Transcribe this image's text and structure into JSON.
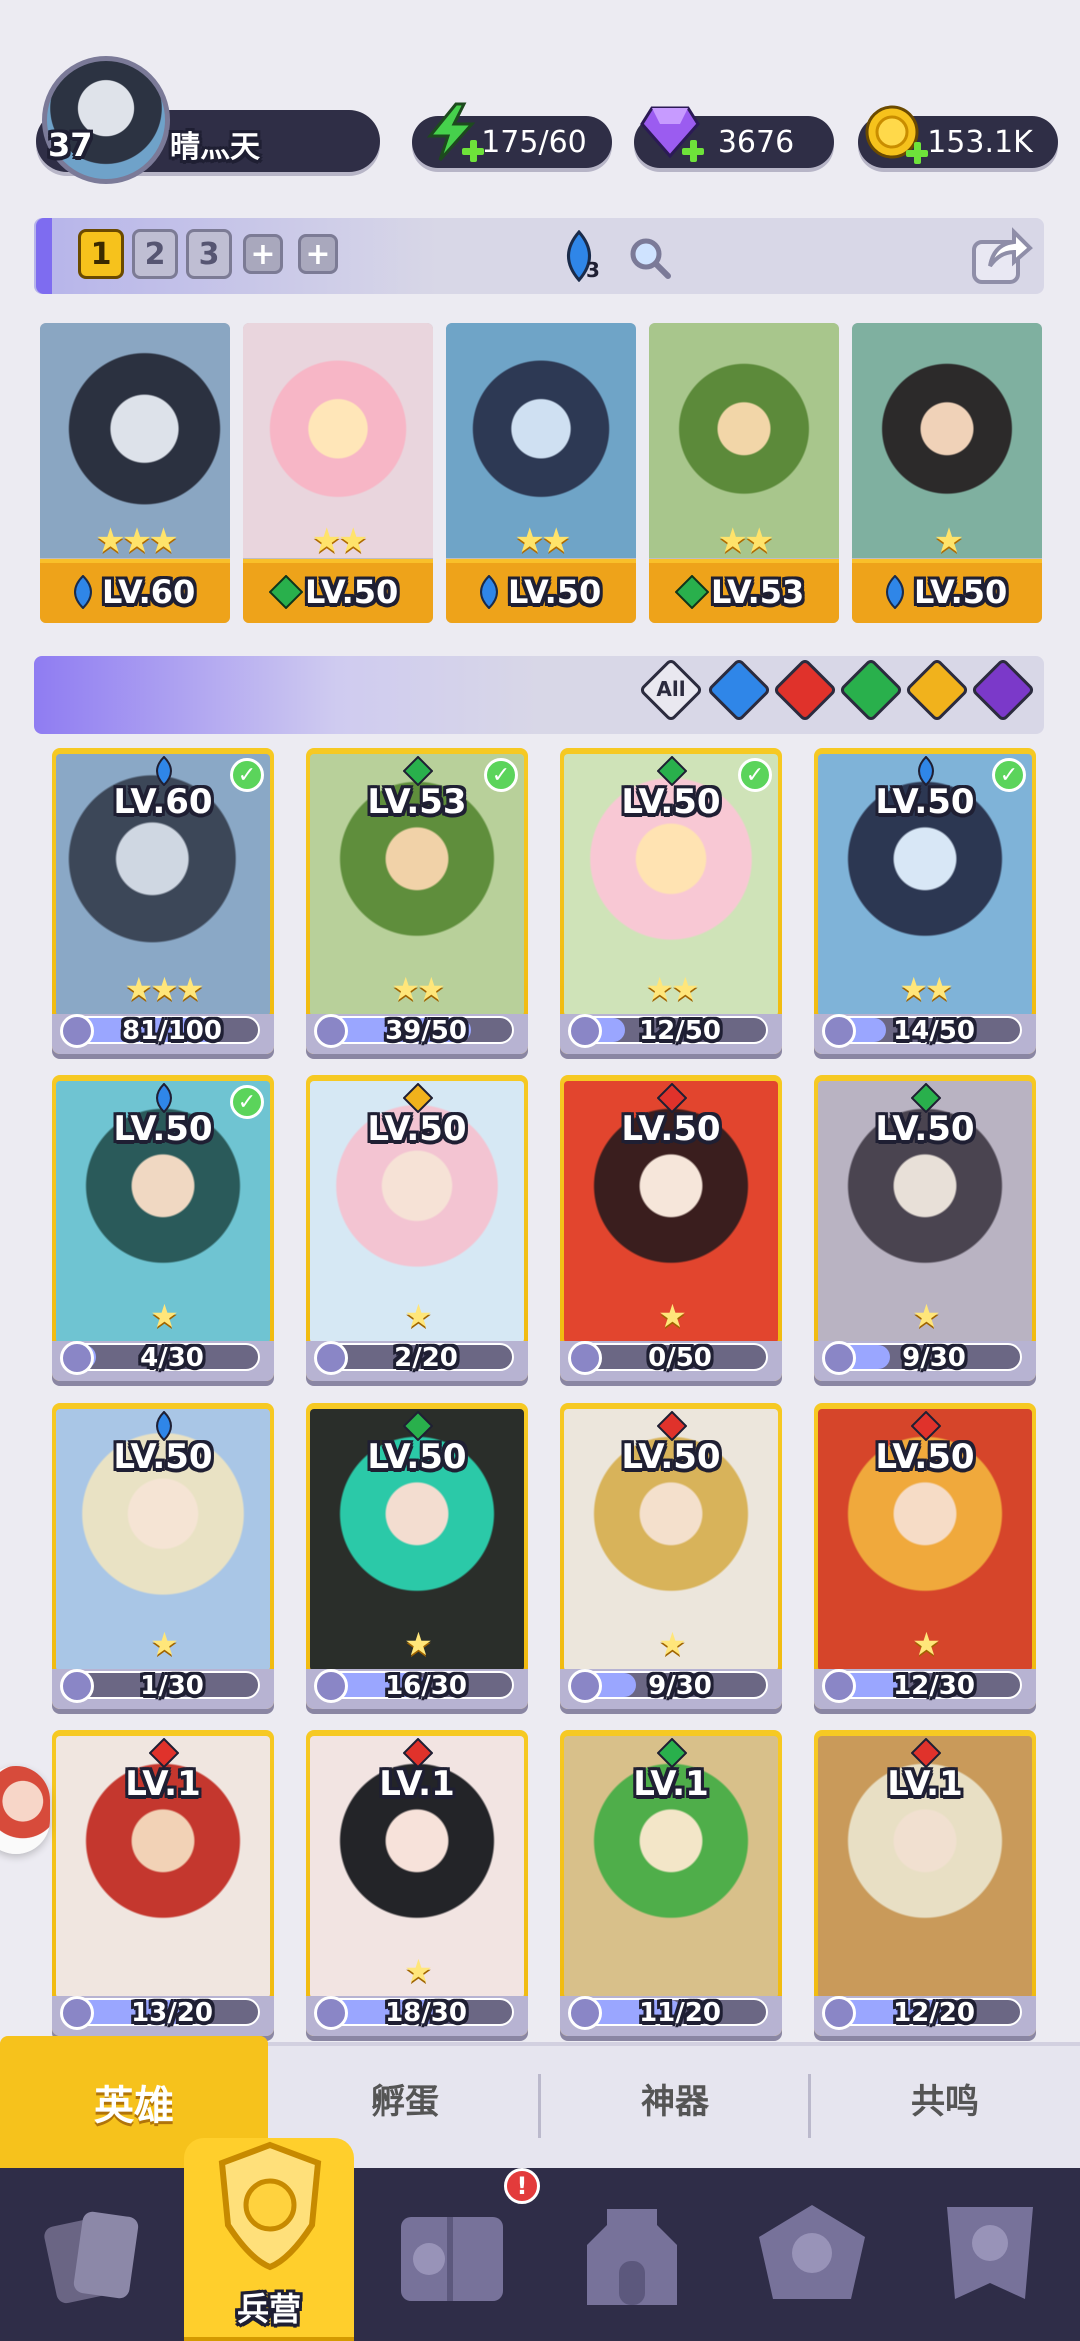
{
  "player": {
    "level": "37",
    "name": "晴灬天"
  },
  "resources": [
    {
      "name": "energy",
      "icon": "lightning-icon",
      "value": "175/60"
    },
    {
      "name": "gems",
      "icon": "diamond-icon",
      "value": "3676"
    },
    {
      "name": "coins",
      "icon": "coin-icon",
      "value": "153.1K"
    }
  ],
  "team_tabs": [
    "1",
    "2",
    "3"
  ],
  "rune_count": "3",
  "team": [
    {
      "level": "LV.60",
      "stars": "★★★",
      "element": "water",
      "color": "#2e7fe0"
    },
    {
      "level": "LV.50",
      "stars": "★★",
      "element": "nature",
      "color": "#2bb34a"
    },
    {
      "level": "LV.50",
      "stars": "★★",
      "element": "water",
      "color": "#2e7fe0"
    },
    {
      "level": "LV.53",
      "stars": "★★",
      "element": "nature",
      "color": "#2bb34a"
    },
    {
      "level": "LV.50",
      "stars": "★",
      "element": "water",
      "color": "#2e7fe0"
    }
  ],
  "filters": {
    "all_label": "All",
    "elements": [
      "water",
      "fire",
      "nature",
      "light",
      "dark"
    ]
  },
  "heroes": [
    {
      "level": "LV.60",
      "element": "water",
      "in_team": true,
      "stars": "★★★",
      "shards": "81/100",
      "progress": 0.81
    },
    {
      "level": "LV.53",
      "element": "nature",
      "in_team": true,
      "stars": "★★",
      "shards": "39/50",
      "progress": 0.78
    },
    {
      "level": "LV.50",
      "element": "nature",
      "in_team": true,
      "stars": "★★",
      "shards": "12/50",
      "progress": 0.24
    },
    {
      "level": "LV.50",
      "element": "water",
      "in_team": true,
      "stars": "★★",
      "shards": "14/50",
      "progress": 0.28
    },
    {
      "level": "LV.50",
      "element": "water",
      "in_team": true,
      "stars": "★",
      "shards": "4/30",
      "progress": 0.13
    },
    {
      "level": "LV.50",
      "element": "light",
      "in_team": false,
      "stars": "★",
      "shards": "2/20",
      "progress": 0.1
    },
    {
      "level": "LV.50",
      "element": "fire",
      "in_team": false,
      "stars": "★",
      "shards": "0/50",
      "progress": 0.0
    },
    {
      "level": "LV.50",
      "element": "nature",
      "in_team": false,
      "stars": "★",
      "shards": "9/30",
      "progress": 0.3
    },
    {
      "level": "LV.50",
      "element": "water",
      "in_team": false,
      "stars": "★",
      "shards": "1/30",
      "progress": 0.03
    },
    {
      "level": "LV.50",
      "element": "nature",
      "in_team": false,
      "stars": "★",
      "shards": "16/30",
      "progress": 0.53
    },
    {
      "level": "LV.50",
      "element": "fire",
      "in_team": false,
      "stars": "★",
      "shards": "9/30",
      "progress": 0.3
    },
    {
      "level": "LV.50",
      "element": "fire",
      "in_team": false,
      "stars": "★",
      "shards": "12/30",
      "progress": 0.4
    },
    {
      "level": "LV.1",
      "element": "fire",
      "in_team": false,
      "stars": "",
      "shards": "13/20",
      "progress": 0.65
    },
    {
      "level": "LV.1",
      "element": "fire",
      "in_team": false,
      "stars": "★",
      "shards": "18/30",
      "progress": 0.6
    },
    {
      "level": "LV.1",
      "element": "nature",
      "in_team": false,
      "stars": "",
      "shards": "11/20",
      "progress": 0.55
    },
    {
      "level": "LV.1",
      "element": "fire",
      "in_team": false,
      "stars": "",
      "shards": "12/20",
      "progress": 0.6
    }
  ],
  "element_colors": {
    "water": "#2f86e8",
    "fire": "#e0322b",
    "nature": "#29b04c",
    "light": "#f1b21c",
    "dark": "#7b39c9"
  },
  "bottom_tabs": [
    "英雄",
    "孵蛋",
    "神器",
    "共鸣"
  ],
  "nav": {
    "active_label": "兵营",
    "badge": "!"
  }
}
